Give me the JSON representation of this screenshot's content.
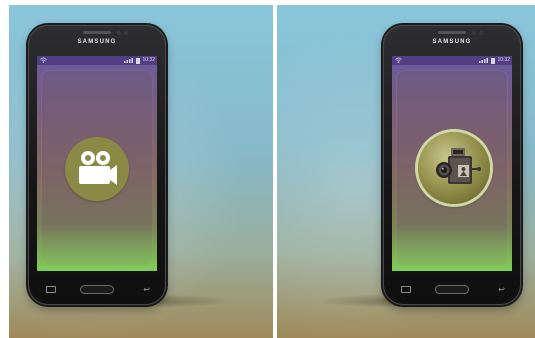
{
  "phones": [
    {
      "brand": "SAMSUNG",
      "status_time": "10:32",
      "app_icon": "video-camera-flat-icon"
    },
    {
      "brand": "SAMSUNG",
      "status_time": "10:32",
      "app_icon": "vintage-movie-camera-3d-icon"
    }
  ],
  "colors": {
    "background_sky": "#8ac6dc",
    "screen_top": "#6b5aa0",
    "screen_bottom": "#7fcf56",
    "icon_olive": "#8a8a46",
    "icon_ring": "#cfd8a4"
  }
}
